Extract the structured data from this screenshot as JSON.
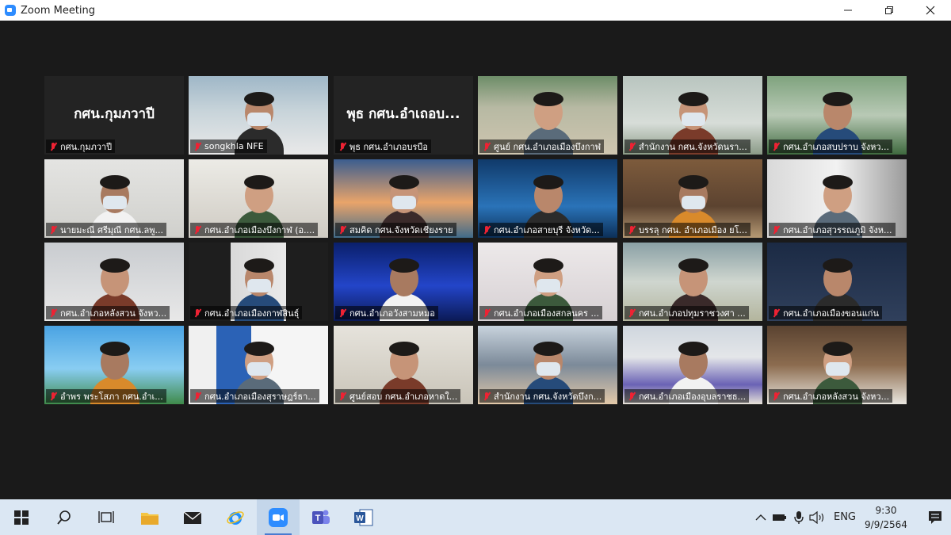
{
  "window": {
    "title": "Zoom Meeting"
  },
  "tiles": [
    {
      "name": "กศน.กุมภวาปี",
      "big": "กศน.กุมภวาปี",
      "video": false,
      "active": false
    },
    {
      "name": "songkhla NFE",
      "video": true,
      "active": false
    },
    {
      "name": "พุธ กศน.อำเภอบรบือ",
      "big": "พุธ กศน.อำเถอบ...",
      "video": false,
      "active": true
    },
    {
      "name": "ศูนย์ กศน.อำเภอเมืองบึงกาฬ",
      "video": true,
      "active": false
    },
    {
      "name": "สำนักงาน กศน.จังหวัดนรา...",
      "video": true,
      "active": false
    },
    {
      "name": "กศน.อำเภอสบปราบ จังหว...",
      "video": true,
      "active": false
    },
    {
      "name": "นายมะณี ศรีมุณี กศน.ลพู...",
      "video": true,
      "active": false
    },
    {
      "name": "กศน.อำเภอเมืองบึงกาฬ (อ....",
      "video": true,
      "active": false
    },
    {
      "name": "สมคิด กศน.จังหวัดเชียงราย",
      "video": true,
      "active": false
    },
    {
      "name": "กศน.อำเภอสายบุรี จังหวัด...",
      "video": true,
      "active": false
    },
    {
      "name": "บรรลุ กศน. อำเภอเมือง ยโ...",
      "video": true,
      "active": false
    },
    {
      "name": "กศน.อำเภอสุวรรณภูมิ จังห...",
      "video": true,
      "active": false
    },
    {
      "name": "กศน.อำเภอหลังสวน จังหว...",
      "video": true,
      "active": false
    },
    {
      "name": "กศน.อำเภอเมืองกาฬสินธุ์",
      "video": true,
      "active": false
    },
    {
      "name": "กศน.อำเภอวังสามหมอ",
      "video": true,
      "active": false
    },
    {
      "name": "กศน.อำเภอเมืองสกลนคร ...",
      "video": true,
      "active": false
    },
    {
      "name": "กศน.อำเภอปทุมราชวงศา ...",
      "video": true,
      "active": false
    },
    {
      "name": "กศน.อำเภอเมืองขอนแก่น",
      "video": true,
      "active": false
    },
    {
      "name": "อำพร พระโสภา กศน.อำเ...",
      "video": true,
      "active": false
    },
    {
      "name": "กศน.อำเภอเมืองสุราษฎร์ธา...",
      "video": true,
      "active": false
    },
    {
      "name": "ศูนย์สอบ กศน.อำเภอหาดใ...",
      "video": true,
      "active": false
    },
    {
      "name": "สำนักงาน กศน.จังหวัดบึงก...",
      "video": true,
      "active": false
    },
    {
      "name": "กศน.อำเภอเมืองอุบลราชธ...",
      "video": true,
      "active": false
    },
    {
      "name": "กศน.อำเภอหลังสวน จังหว...",
      "video": true,
      "active": false
    }
  ],
  "taskbar": {
    "apps": [
      "start",
      "search",
      "task-view",
      "file-explorer",
      "mail",
      "internet-explorer",
      "zoom",
      "teams",
      "word"
    ],
    "lang": "ENG",
    "time": "9:30",
    "date": "9/9/2564"
  }
}
